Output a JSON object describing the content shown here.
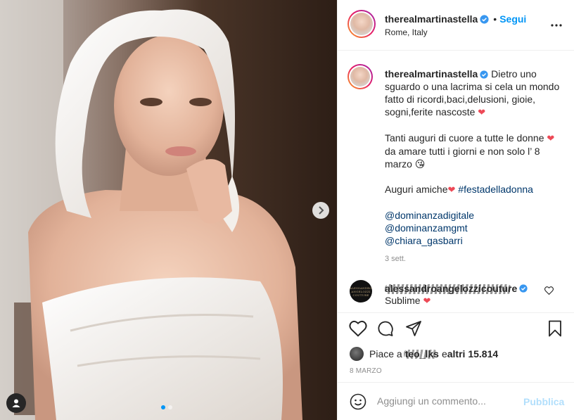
{
  "post": {
    "author": "therealmartinastella",
    "location": "Rome, Italy",
    "follow_separator": "•",
    "follow_label": "Segui",
    "more_icon": "more-horizontal-icon"
  },
  "caption": {
    "author": "therealmartinastella",
    "line1": " Dietro uno sguardo o una lacrima si cela un mondo fatto di ricordi,baci,delusioni, gioie, sogni,ferite nascoste ",
    "line2a": "Tanti auguri di cuore a tutte le donne ",
    "line2b": " da amare tutti i giorni e non solo l’ 8 marzo ",
    "line3": "Auguri amiche",
    "hashtag": "#festadelladonna",
    "mentions": [
      "@dominanzadigitale",
      "@dominanzamgmt",
      "@chiara_gasbarri"
    ],
    "time_ago": "3 sett.",
    "heart": "❤",
    "wink": "😘"
  },
  "comment": {
    "author": "alessandroangelozzicouture",
    "text": "Sublime ",
    "heart": "❤",
    "avatar_text": "ALESSANDRO ANGELOZZI COUTURE"
  },
  "likes": {
    "prefix": "Piace a ",
    "liked_user": "teo_lks",
    "suffix_a": " e ",
    "suffix_b": "altri 15.814"
  },
  "date": "8 MARZO",
  "composer": {
    "placeholder": "Aggiungi un commento...",
    "publish_label": "Pubblica"
  },
  "colors": {
    "link_blue": "#0095f6",
    "publish_disabled": "#b2dffc",
    "heart_red": "#ed4956",
    "verified_blue": "#3897f0"
  },
  "carousel": {
    "current": 1,
    "total": 2
  }
}
